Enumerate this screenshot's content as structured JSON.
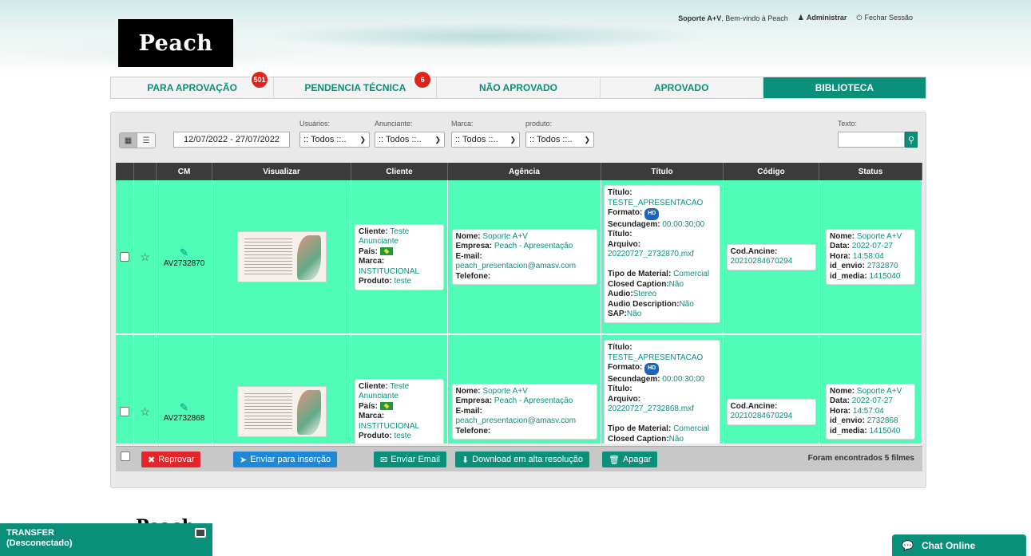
{
  "header": {
    "logo": "Peach",
    "user": "Soporte A+V",
    "welcome": ", Bem-vindo à Peach",
    "admin_label": "Administrar",
    "logout_label": "Fechar Sessão"
  },
  "tabs": [
    {
      "label": "PARA APROVAÇÃO",
      "badge": "501"
    },
    {
      "label": "PENDENCIA TÉCNICA",
      "badge": "6"
    },
    {
      "label": "NÃO APROVADO"
    },
    {
      "label": "APROVADO"
    },
    {
      "label": "BIBLIOTECA",
      "active": true
    }
  ],
  "filters": {
    "date_range": "12/07/2022 - 27/07/2022",
    "usuarios_label": "Usuários:",
    "usuarios_value": ":: Todos ::..",
    "anunciante_label": "Anunciante:",
    "anunciante_value": ":: Todos ::..",
    "marca_label": "Marca:",
    "marca_value": ":: Todos ::..",
    "produto_label": "produto:",
    "produto_value": ":: Todos ::..",
    "texto_label": "Texto:"
  },
  "table": {
    "headers": [
      "CM",
      "Visualizar",
      "Cliente",
      "Agência",
      "Título",
      "Código",
      "Status"
    ],
    "rows": [
      {
        "cm": "AV2732870",
        "cliente": {
          "cliente_l": "Cliente:",
          "cliente": "Teste Anunciante",
          "pais_l": "País:",
          "marca_l": "Marca:",
          "marca": "INSTITUCIONAL",
          "produto_l": "Produto:",
          "produto": "teste"
        },
        "agencia": {
          "nome_l": "Nome:",
          "nome": "Soporte A+V",
          "empresa_l": "Empresa:",
          "empresa": "Peach - Apresentação",
          "email_l": "E-mail:",
          "email": "peach_presentacion@amasv.com",
          "telefone_l": "Telefone:"
        },
        "titulo": {
          "titulo_l": "Título:",
          "titulo": "TESTE_APRESENTACAO",
          "formato_l": "Formato:",
          "hd": "HD",
          "secundagem_l": "Secundagem:",
          "secundagem": "00:00:30;00",
          "titulo2_l": "Título:",
          "arquivo_l": "Arquivo:",
          "arquivo": "20220727_2732870.mxf",
          "tipo_l": "Tipo de Material:",
          "tipo": "Comercial",
          "cc_l": "Closed Caption:",
          "cc": "Não",
          "audio_l": "Audio:",
          "audio": "Stereo",
          "ad_l": "Audio Description:",
          "ad": "Não",
          "sap_l": "SAP:",
          "sap": "Não"
        },
        "codigo": {
          "label": "Cod.Ancine:",
          "value": "20210284670294"
        },
        "status": {
          "nome_l": "Nome:",
          "nome": "Soporte A+V",
          "data_l": "Data:",
          "data": "2022-07-27",
          "hora_l": "Hora:",
          "hora": "14:58:04",
          "envio_l": "id_envio:",
          "envio": "2732870",
          "media_l": "id_media:",
          "media": "1415040"
        }
      },
      {
        "cm": "AV2732868",
        "cliente": {
          "cliente_l": "Cliente:",
          "cliente": "Teste Anunciante",
          "pais_l": "País:",
          "marca_l": "Marca:",
          "marca": "INSTITUCIONAL",
          "produto_l": "Produto:",
          "produto": "teste"
        },
        "agencia": {
          "nome_l": "Nome:",
          "nome": "Soporte A+V",
          "empresa_l": "Empresa:",
          "empresa": "Peach - Apresentação",
          "email_l": "E-mail:",
          "email": "peach_presentacion@amasv.com",
          "telefone_l": "Telefone:"
        },
        "titulo": {
          "titulo_l": "Título:",
          "titulo": "TESTE_APRESENTACAO",
          "formato_l": "Formato:",
          "hd": "HD",
          "secundagem_l": "Secundagem:",
          "secundagem": "00:00:30;00",
          "titulo2_l": "Título:",
          "arquivo_l": "Arquivo:",
          "arquivo": "20220727_2732868.mxf",
          "tipo_l": "Tipo de Material:",
          "tipo": "Comercial",
          "cc_l": "Closed Caption:",
          "cc": "Não"
        },
        "codigo": {
          "label": "Cod.Ancine:",
          "value": "20210284670294"
        },
        "status": {
          "nome_l": "Nome:",
          "nome": "Soporte A+V",
          "data_l": "Data:",
          "data": "2022-07-27",
          "hora_l": "Hora:",
          "hora": "14:57:04",
          "envio_l": "id_envio:",
          "envio": "2732868",
          "media_l": "id_media:",
          "media": "1415040"
        }
      }
    ]
  },
  "actions": {
    "reprovar": "Reprovar",
    "enviar_insercao": "Enviar para inserção",
    "enviar_email": "Enviar Email",
    "download": "Download em alta resolução",
    "apagar": "Apagar",
    "found": "Foram encontrados 5 filmes"
  },
  "footer": {
    "logo": "Peach",
    "transfer_title": "TRANSFER",
    "transfer_status": "(Desconectado)",
    "chat": "Chat Online"
  },
  "colors": {
    "accent": "#0a8f7a",
    "row_bg": "#4efcb7",
    "badge": "#e2231a"
  }
}
